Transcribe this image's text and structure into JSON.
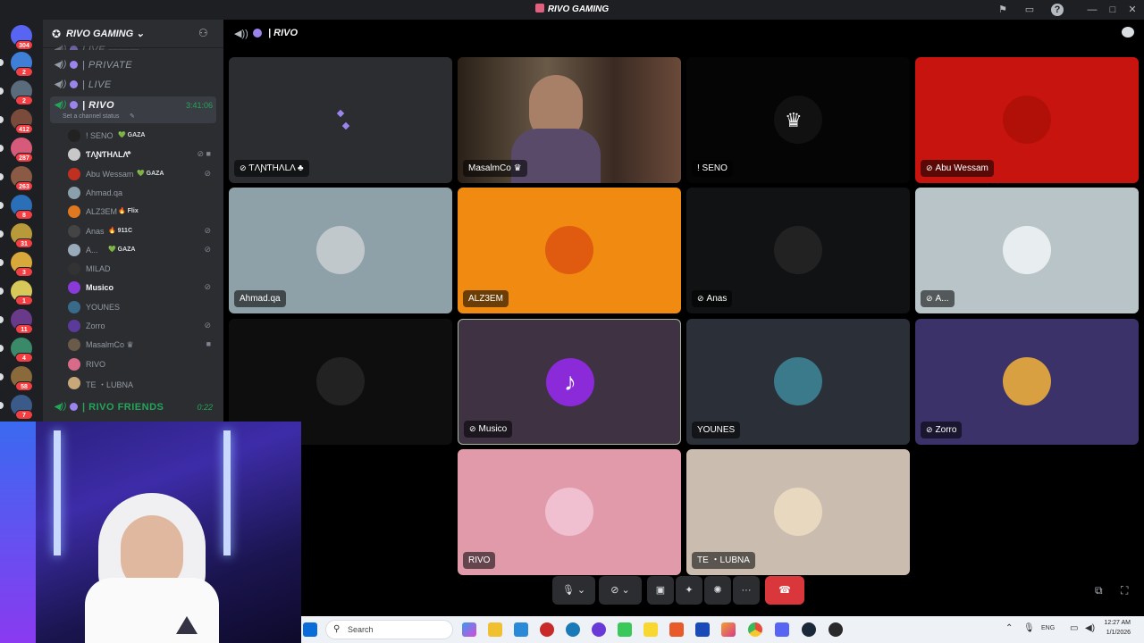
{
  "app": {
    "title": "RIVO GAMING"
  },
  "rail": {
    "servers": [
      {
        "badge": "304",
        "color": "#5865f2"
      },
      {
        "badge": "2",
        "color": "#3f7fd8"
      },
      {
        "badge": "2",
        "color": "#5a6b7c"
      },
      {
        "badge": "412",
        "color": "#7a4b3a"
      },
      {
        "badge": "287",
        "color": "#d85a7a"
      },
      {
        "badge": "263",
        "color": "#8a5a44"
      },
      {
        "badge": "8",
        "color": "#2a6fb8"
      },
      {
        "badge": "31",
        "color": "#b89a3a"
      },
      {
        "badge": "3",
        "color": "#d8a83a"
      },
      {
        "badge": "1",
        "color": "#d8c85a"
      },
      {
        "badge": "11",
        "color": "#6a3a8a"
      },
      {
        "badge": "4",
        "color": "#3a8a6a"
      },
      {
        "badge": "58",
        "color": "#8a6a3a"
      },
      {
        "badge": "7",
        "color": "#3a5a8a"
      }
    ]
  },
  "guild": {
    "name": "RIVO GAMING",
    "chevron": "⌄"
  },
  "channels": [
    {
      "name": "LIVE  ▬▬▬",
      "faded": true
    },
    {
      "name": "| PRIVATE"
    },
    {
      "name": "| LIVE"
    },
    {
      "name": "| RIVO",
      "active": true,
      "time": "3:41:06",
      "status": "Set a channel status"
    }
  ],
  "voice_users": [
    {
      "name": "! SENO",
      "tag": "💚 GAZA",
      "icons": "",
      "color": "#222"
    },
    {
      "name": "ƬΛƝƬHΛLΛ",
      "tag": "♣",
      "icons": "⊘ ■",
      "color": "#c8c8c8",
      "bold": true
    },
    {
      "name": "Abu Wessam",
      "tag": "💚 GAZA",
      "icons": "⊘",
      "color": "#c03020"
    },
    {
      "name": "Ahmad.qa",
      "tag": "",
      "icons": "",
      "color": "#8aa0ac"
    },
    {
      "name": "ALZ3EM",
      "tag": "🔥 Flix",
      "icons": "",
      "color": "#e07820"
    },
    {
      "name": "Anas",
      "tag": "🔥 911C",
      "icons": "⊘",
      "color": "#444"
    },
    {
      "name": "A...",
      "tag": "💚 GAZA",
      "icons": "⊘",
      "color": "#9ab"
    },
    {
      "name": "MILAD",
      "tag": "",
      "icons": "",
      "color": "#333"
    },
    {
      "name": "Musico",
      "tag": "",
      "icons": "⊘",
      "color": "#8a3ad8",
      "bold": true
    },
    {
      "name": "YOUNES",
      "tag": "",
      "icons": "",
      "color": "#3a6a8a"
    },
    {
      "name": "Zorro",
      "tag": "",
      "icons": "⊘",
      "color": "#5a3a9a"
    },
    {
      "name": "MasalmCo ♛",
      "tag": "",
      "icons": "■",
      "color": "#6a5a4a"
    },
    {
      "name": "RIVO",
      "tag": "",
      "icons": "",
      "color": "#d86a8a"
    },
    {
      "name": "TE ・LUBNA",
      "tag": "",
      "icons": "",
      "color": "#c8a87a"
    }
  ],
  "channel_bottom": {
    "name": "| RIVO FRIENDS",
    "time": "0:22"
  },
  "topbar": {
    "channel": "| RIVO"
  },
  "tiles": [
    {
      "name": "ƬΛƝƬHΛLΛ ♣",
      "bg": "#2b2d31",
      "muted": true,
      "avatar": ""
    },
    {
      "name": "MasalmCo ♛",
      "bg": "#3a2c22",
      "muted": false,
      "avatar": "video"
    },
    {
      "name": "! SENO",
      "bg": "#050505",
      "muted": false,
      "avatar": "#111"
    },
    {
      "name": "Abu Wessam",
      "bg": "#c8140e",
      "muted": true,
      "avatar": "#b01008"
    },
    {
      "name": "Ahmad.qa",
      "bg": "#8ea0a8",
      "muted": false,
      "avatar": "#c0c8cc"
    },
    {
      "name": "ALZ3EM",
      "bg": "#f08a10",
      "muted": false,
      "avatar": "#e05a10"
    },
    {
      "name": "Anas",
      "bg": "#111213",
      "muted": true,
      "avatar": "#222"
    },
    {
      "name": "A...",
      "bg": "#b8c4c8",
      "muted": true,
      "avatar": "#e8eef0"
    },
    {
      "name": "",
      "bg": "#0e0e0f",
      "muted": false,
      "avatar": "#222"
    },
    {
      "name": "Musico",
      "bg": "#3f3243",
      "muted": true,
      "avatar": "#8a2ad8"
    },
    {
      "name": "YOUNES",
      "bg": "#2b2f38",
      "muted": false,
      "avatar": "#3a7a8a"
    },
    {
      "name": "Zorro",
      "bg": "#3a3268",
      "muted": true,
      "avatar": "#d8a040"
    },
    {
      "name": "RIVO",
      "bg": "#e09aaa",
      "muted": false,
      "avatar": "#f0c0d0"
    },
    {
      "name": "TE ・LUBNA",
      "bg": "#cbbcb0",
      "muted": false,
      "avatar": "#e8d8c0"
    }
  ],
  "taskbar": {
    "search_placeholder": "Search",
    "lang": "ENG",
    "time": "12:27 AM",
    "date": "1/1/2026"
  },
  "colors": {
    "accent": "#5865f2",
    "danger": "#da373c",
    "online": "#23a55a"
  }
}
